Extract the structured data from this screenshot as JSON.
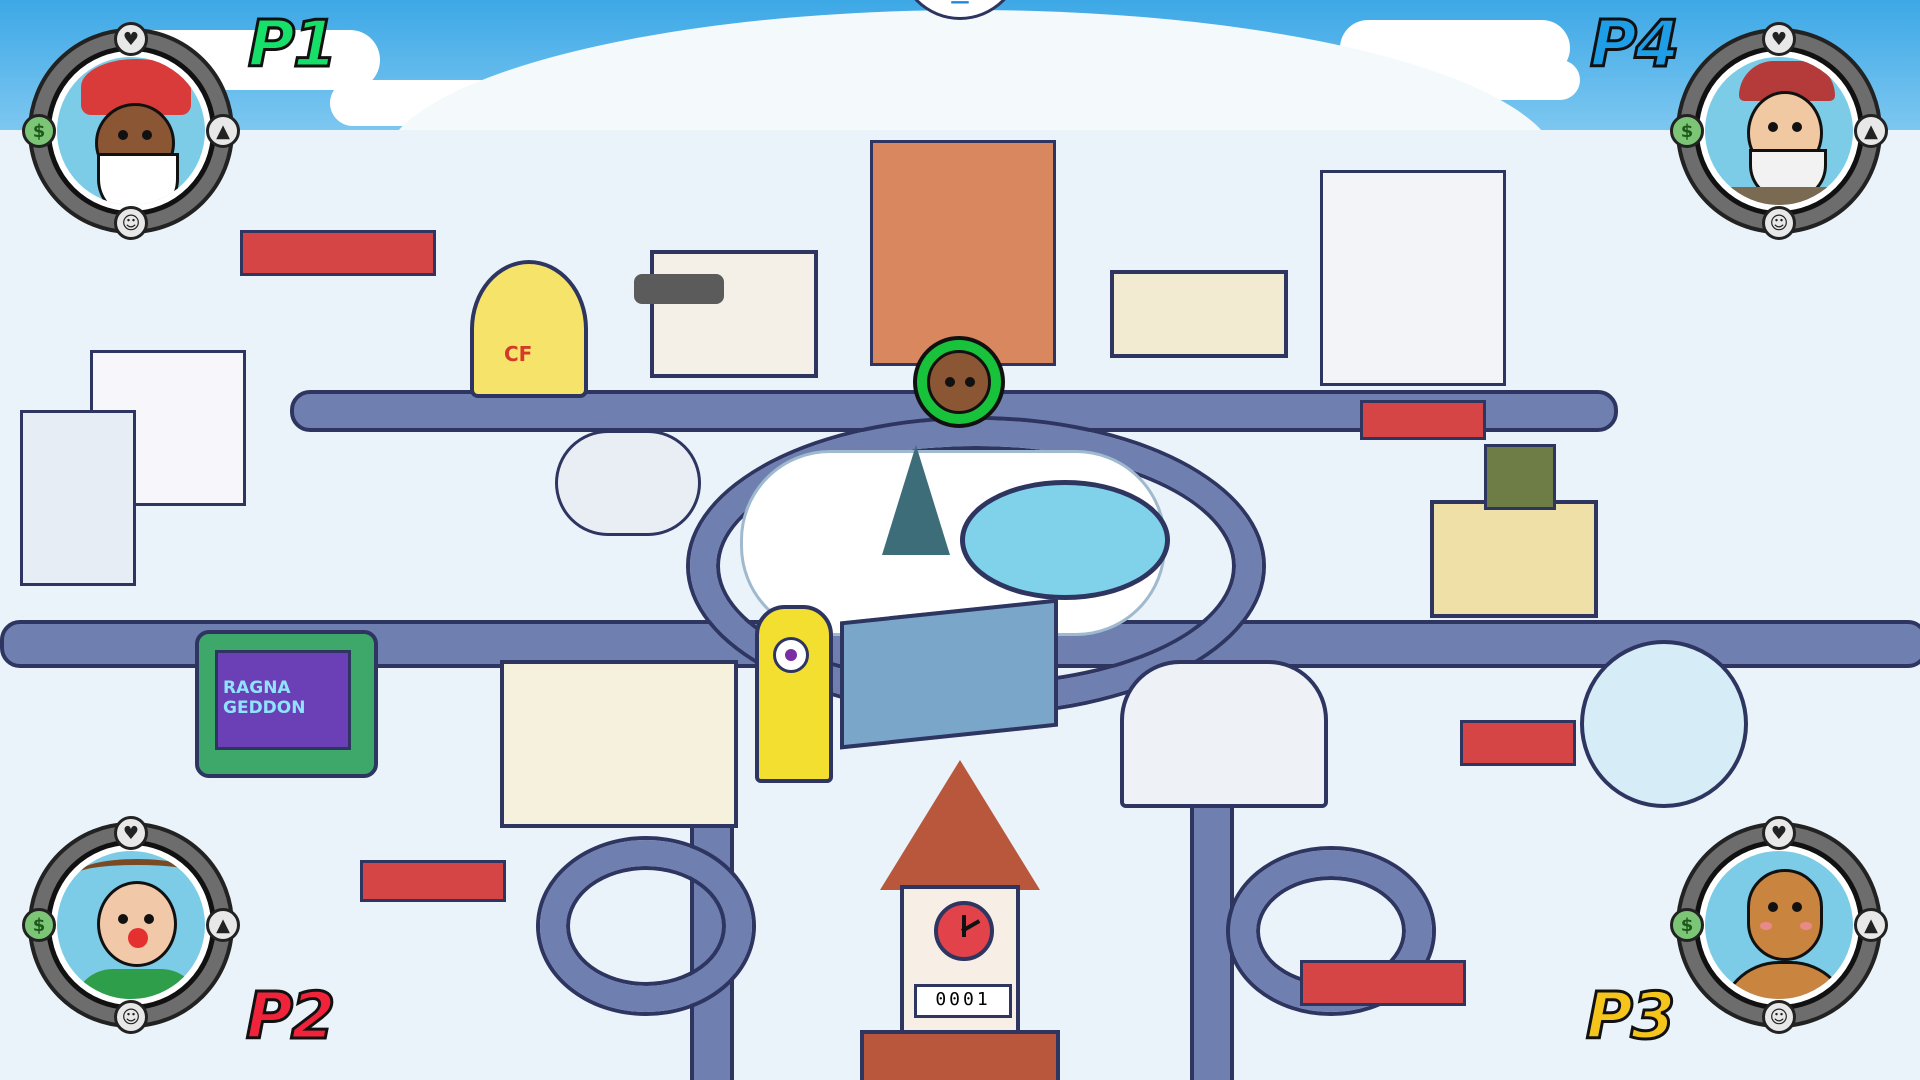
{
  "menu": {
    "icon": "menu-icon",
    "glyph": "≡"
  },
  "players": [
    {
      "label": "P1",
      "label_color": "#16e06a",
      "character": "santa-with-glasses",
      "skin": "#8a5634"
    },
    {
      "label": "P2",
      "label_color": "#f0233a",
      "character": "reindeer-antlers-girl",
      "skin": "#f2c9a8"
    },
    {
      "label": "P3",
      "label_color": "#f6c51b",
      "character": "gingerbread-man",
      "skin": "#c9843f"
    },
    {
      "label": "P4",
      "label_color": "#1f9ee8",
      "character": "bearded-elf",
      "skin": "#f0c8a2"
    }
  ],
  "portrait_buttons": {
    "top": {
      "icon": "heart-icon",
      "glyph": "♥"
    },
    "left": {
      "icon": "money-icon",
      "glyph": "$"
    },
    "right": {
      "icon": "graduation-cap-icon",
      "glyph": "▲"
    },
    "bottom": {
      "icon": "smile-icon",
      "glyph": "☺"
    }
  },
  "map": {
    "landmarks": [
      {
        "name": "chicken-restaurant",
        "sign": "CF"
      },
      {
        "name": "gym",
        "sign": ""
      },
      {
        "name": "tv-studio",
        "sign": "RAGNA GEDDON"
      },
      {
        "name": "bank",
        "sign": ""
      },
      {
        "name": "hot-dog-stand",
        "sign": ""
      },
      {
        "name": "theater",
        "sign": ""
      },
      {
        "name": "city-hall",
        "sign": ""
      },
      {
        "name": "ice-arena",
        "sign": ""
      }
    ],
    "active_token": {
      "icon": "player-token-icon",
      "ring_color": "#18c23a"
    }
  },
  "clock": {
    "counter": "0001"
  }
}
